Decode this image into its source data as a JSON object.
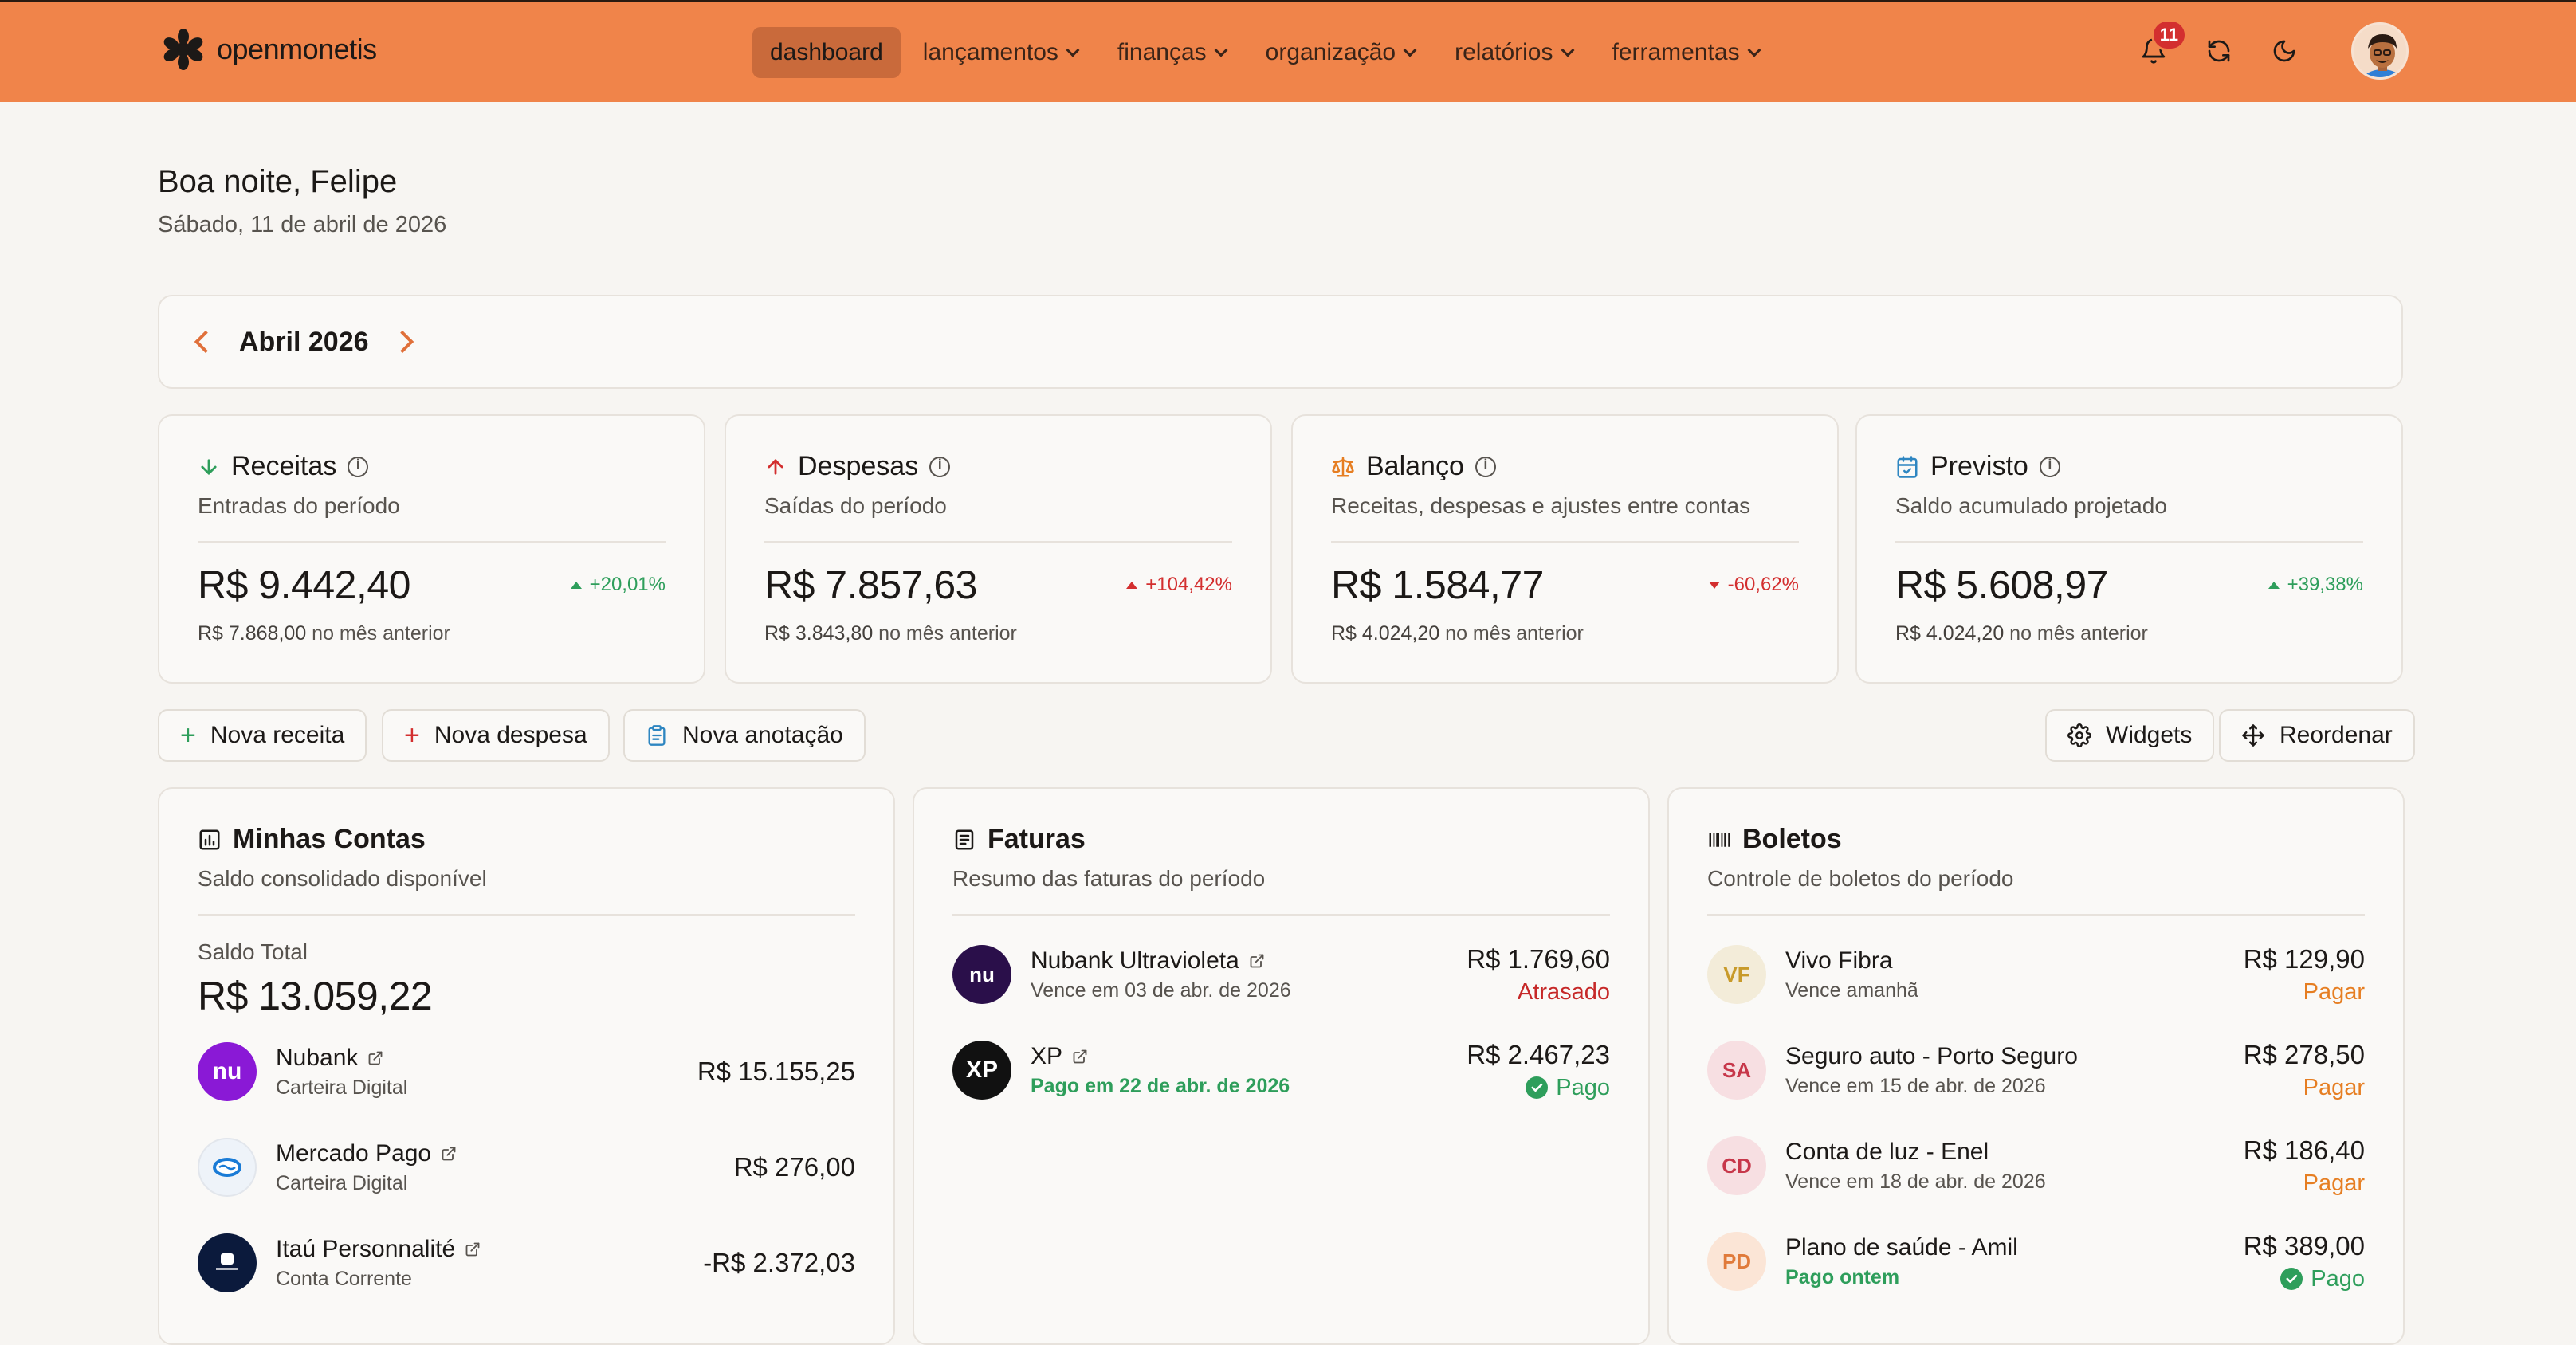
{
  "app": {
    "name": "openmonetis"
  },
  "nav": {
    "items": [
      {
        "label": "dashboard",
        "active": true,
        "dropdown": false
      },
      {
        "label": "lançamentos",
        "dropdown": true
      },
      {
        "label": "finanças",
        "dropdown": true
      },
      {
        "label": "organização",
        "dropdown": true
      },
      {
        "label": "relatórios",
        "dropdown": true
      },
      {
        "label": "ferramentas",
        "dropdown": true
      }
    ],
    "notifications_count": "11",
    "icons": [
      "bell-icon",
      "refresh-icon",
      "moon-icon",
      "avatar"
    ]
  },
  "greeting": {
    "title": "Boa noite, Felipe",
    "date": "Sábado, 11 de abril de 2026"
  },
  "period": {
    "label": "Abril 2026"
  },
  "stats": [
    {
      "title": "Receitas",
      "subtitle": "Entradas do período",
      "value": "R$ 9.442,40",
      "delta": "+20,01%",
      "prev_value": "R$ 7.868,00",
      "prev_suffix": "no mês anterior",
      "icon": "arrow-down-icon",
      "color": "#2e9e5b"
    },
    {
      "title": "Despesas",
      "subtitle": "Saídas do período",
      "value": "R$ 7.857,63",
      "delta": "+104,42%",
      "prev_value": "R$ 3.843,80",
      "prev_suffix": "no mês anterior",
      "icon": "arrow-up-icon",
      "color": "#d32f2f"
    },
    {
      "title": "Balanço",
      "subtitle": "Receitas, despesas e ajustes entre contas",
      "value": "R$ 1.584,77",
      "delta": "-60,62%",
      "prev_value": "R$ 4.024,20",
      "prev_suffix": "no mês anterior",
      "icon": "scale-icon",
      "color": "#e67e22"
    },
    {
      "title": "Previsto",
      "subtitle": "Saldo acumulado projetado",
      "value": "R$ 5.608,97",
      "delta": "+39,38%",
      "prev_value": "R$ 4.024,20",
      "prev_suffix": "no mês anterior",
      "icon": "calendar-icon",
      "color": "#2e86c1"
    }
  ],
  "actions": {
    "new_income": "Nova receita",
    "new_expense": "Nova despesa",
    "new_note": "Nova anotação",
    "widgets": "Widgets",
    "reorder": "Reordenar"
  },
  "accounts": {
    "title": "Minhas Contas",
    "subtitle": "Saldo consolidado disponível",
    "total_label": "Saldo Total",
    "total_value": "R$ 13.059,22",
    "items": [
      {
        "name": "Nubank",
        "type": "Carteira Digital",
        "amount": "R$ 15.155,25"
      },
      {
        "name": "Mercado Pago",
        "type": "Carteira Digital",
        "amount": "R$ 276,00"
      },
      {
        "name": "Itaú Personnalité",
        "type": "Conta Corrente",
        "amount": "-R$ 2.372,03"
      }
    ]
  },
  "invoices": {
    "title": "Faturas",
    "subtitle": "Resumo das faturas do período",
    "items": [
      {
        "name": "Nubank Ultravioleta",
        "meta": "Vence em 03 de abr. de 2026",
        "amount": "R$ 1.769,60",
        "status": "Atrasado"
      },
      {
        "name": "XP",
        "meta": "Pago em 22 de abr. de 2026",
        "amount": "R$ 2.467,23",
        "status": "Pago"
      }
    ]
  },
  "bills": {
    "title": "Boletos",
    "subtitle": "Controle de boletos do período",
    "items": [
      {
        "initials": "VF",
        "name": "Vivo Fibra",
        "meta": "Vence amanhã",
        "amount": "R$ 129,90",
        "status": "Pagar"
      },
      {
        "initials": "SA",
        "name": "Seguro auto - Porto Seguro",
        "meta": "Vence em 15 de abr. de 2026",
        "amount": "R$ 278,50",
        "status": "Pagar"
      },
      {
        "initials": "CD",
        "name": "Conta de luz - Enel",
        "meta": "Vence em 18 de abr. de 2026",
        "amount": "R$ 186,40",
        "status": "Pagar"
      },
      {
        "initials": "PD",
        "name": "Plano de saúde - Amil",
        "meta": "Pago ontem",
        "amount": "R$ 389,00",
        "status": "Pago"
      }
    ]
  },
  "colors": {
    "brand": "#f0844a",
    "positive": "#2e9e5b",
    "negative": "#d32f2f",
    "warning": "#e67e22"
  }
}
